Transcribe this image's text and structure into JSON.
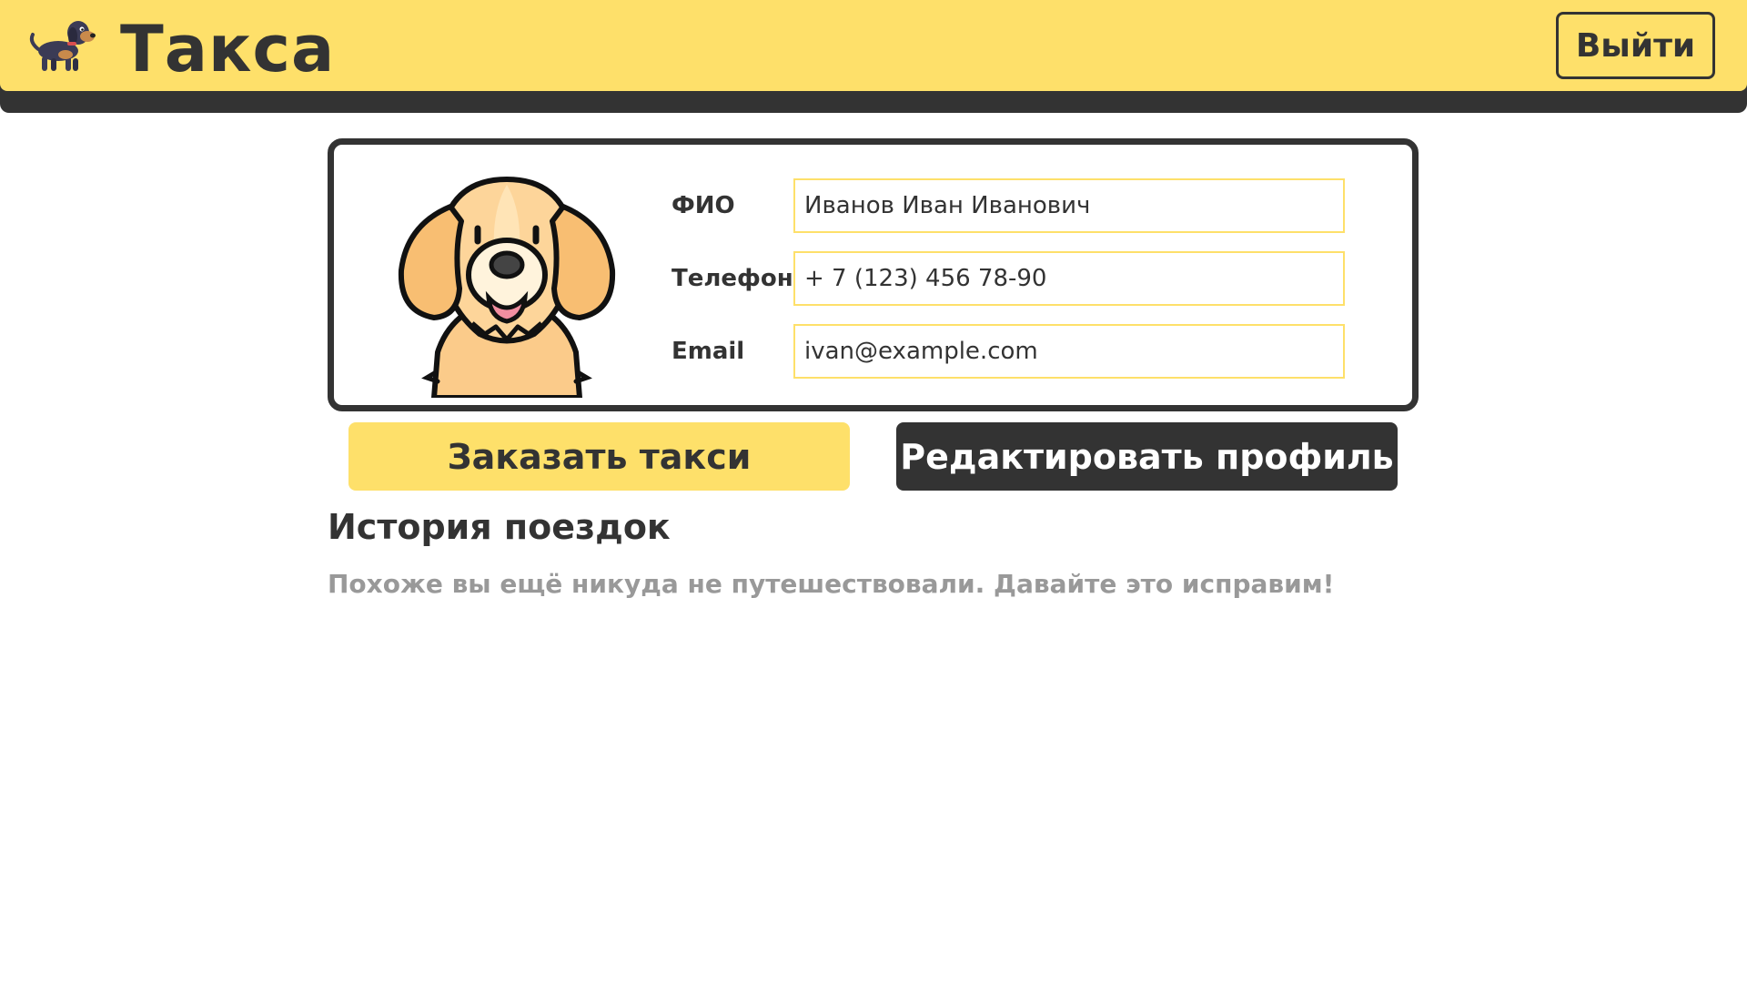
{
  "header": {
    "brand": "Такса",
    "logo_icon": "dachshund-icon",
    "logout_label": "Выйти",
    "colors": {
      "accent": "#FEE06A",
      "dark": "#333333"
    }
  },
  "profile": {
    "avatar_icon": "dog-avatar-icon",
    "fields": [
      {
        "label": "ФИО",
        "value": "Иванов Иван Иванович"
      },
      {
        "label": "Телефон",
        "value": "+ 7 (123) 456 78-90"
      },
      {
        "label": "Email",
        "value": "ivan@example.com"
      }
    ]
  },
  "actions": {
    "order_label": "Заказать такси",
    "edit_label": "Редактировать профиль"
  },
  "history": {
    "title": "История поездок",
    "empty_message": "Похоже вы ещё никуда не путешествовали.  Давайте это исправим!"
  }
}
